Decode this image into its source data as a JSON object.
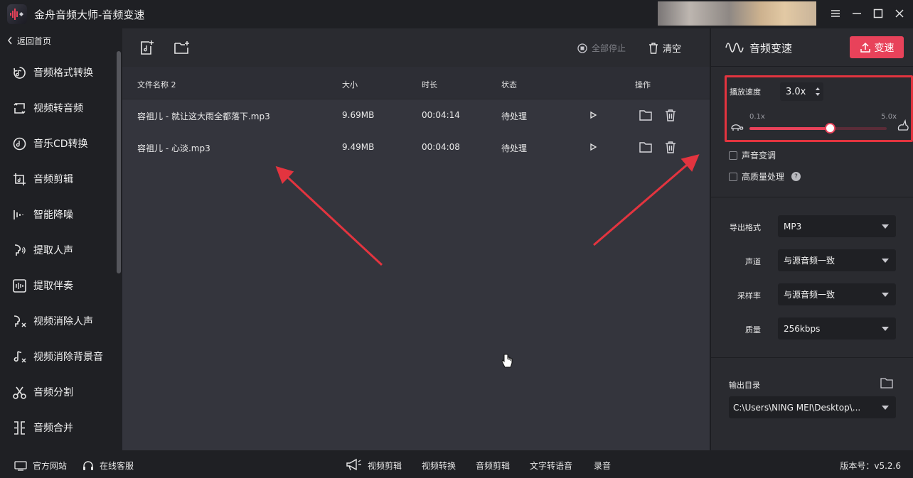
{
  "app": {
    "title": "金舟音频大师-音频变速"
  },
  "sidebar": {
    "back_label": "返回首页",
    "items": [
      {
        "label": "音频格式转换",
        "icon": "audio-convert-icon"
      },
      {
        "label": "视频转音频",
        "icon": "video-to-audio-icon"
      },
      {
        "label": "音乐CD转换",
        "icon": "cd-icon"
      },
      {
        "label": "音频剪辑",
        "icon": "audio-cut-icon"
      },
      {
        "label": "智能降噪",
        "icon": "noise-reduction-icon"
      },
      {
        "label": "提取人声",
        "icon": "extract-voice-icon"
      },
      {
        "label": "提取伴奏",
        "icon": "extract-accompaniment-icon"
      },
      {
        "label": "视频消除人声",
        "icon": "video-remove-voice-icon"
      },
      {
        "label": "视频消除背景音",
        "icon": "video-remove-bgm-icon"
      },
      {
        "label": "音频分割",
        "icon": "scissors-icon"
      },
      {
        "label": "音频合并",
        "icon": "merge-icon"
      }
    ]
  },
  "toolbar": {
    "stop_all_label": "全部停止",
    "clear_label": "清空"
  },
  "table": {
    "headers": {
      "name": "文件名称 2",
      "size": "大小",
      "duration": "时长",
      "status": "状态",
      "actions": "操作"
    },
    "rows": [
      {
        "name": "容祖儿 - 就让这大雨全都落下.mp3",
        "size": "9.69MB",
        "duration": "00:04:14",
        "status": "待处理"
      },
      {
        "name": "容祖儿 - 心淡.mp3",
        "size": "9.49MB",
        "duration": "00:04:08",
        "status": "待处理"
      }
    ]
  },
  "panel": {
    "title": "音频变速",
    "speed_button_label": "变速",
    "speed_label": "播放速度",
    "speed_value": "3.0x",
    "range_min": "0.1x",
    "range_max": "5.0x",
    "slider_fraction": 0.59,
    "pitch_label": "声音变调",
    "hq_label": "高质量处理",
    "help_glyph": "?",
    "format_label": "导出格式",
    "format_value": "MP3",
    "channel_label": "声道",
    "channel_value": "与源音频一致",
    "samplerate_label": "采样率",
    "samplerate_value": "与源音频一致",
    "quality_label": "质量",
    "quality_value": "256kbps",
    "output_label": "输出目录",
    "output_path": "C:\\Users\\NING MEI\\Desktop\\..."
  },
  "bottom": {
    "website_label": "官方网站",
    "service_label": "在线客服",
    "links": [
      "视频剪辑",
      "视频转换",
      "音频剪辑",
      "文字转语音",
      "录音"
    ],
    "version": "版本号：v5.2.6"
  },
  "colors": {
    "accent": "#e8425a",
    "highlight_box": "#e3343f",
    "background": "#2a2b30"
  }
}
